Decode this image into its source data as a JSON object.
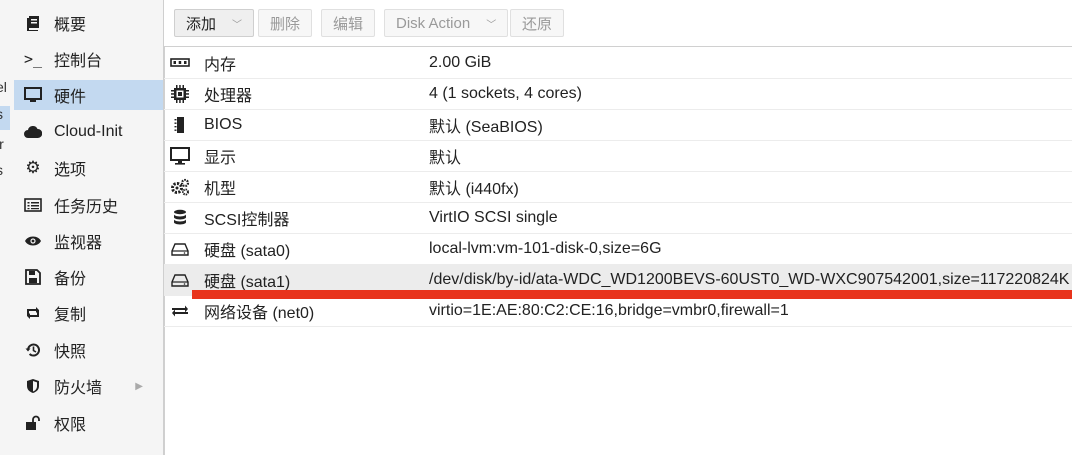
{
  "left_fragments": [
    "el",
    "s",
    "ir",
    "s"
  ],
  "nav": {
    "items": [
      {
        "label": "概要",
        "icon": "summary-icon"
      },
      {
        "label": "控制台",
        "icon": "console-icon"
      },
      {
        "label": "硬件",
        "icon": "monitor-icon",
        "active": true
      },
      {
        "label": "Cloud-Init",
        "icon": "cloud-icon"
      },
      {
        "label": "选项",
        "icon": "gear-icon"
      },
      {
        "label": "任务历史",
        "icon": "list-icon"
      },
      {
        "label": "监视器",
        "icon": "eye-icon"
      },
      {
        "label": "备份",
        "icon": "floppy-icon"
      },
      {
        "label": "复制",
        "icon": "retweet-icon"
      },
      {
        "label": "快照",
        "icon": "history-icon"
      },
      {
        "label": "防火墙",
        "icon": "shield-icon",
        "chevron": true
      },
      {
        "label": "权限",
        "icon": "unlock-icon"
      }
    ]
  },
  "toolbar": {
    "add_label": "添加",
    "remove_label": "删除",
    "edit_label": "编辑",
    "disk_action_label": "Disk Action",
    "revert_label": "还原"
  },
  "hardware": {
    "rows": [
      {
        "name": "内存",
        "value": "2.00 GiB",
        "icon": "memory-icon"
      },
      {
        "name": "处理器",
        "value": "4 (1 sockets, 4 cores)",
        "icon": "cpu-icon"
      },
      {
        "name": "BIOS",
        "value": "默认 (SeaBIOS)",
        "icon": "microchip-icon"
      },
      {
        "name": "显示",
        "value": "默认",
        "icon": "desktop-icon"
      },
      {
        "name": "机型",
        "value": "默认 (i440fx)",
        "icon": "cogs-icon"
      },
      {
        "name": "SCSI控制器",
        "value": "VirtIO SCSI single",
        "icon": "database-icon"
      },
      {
        "name": "硬盘 (sata0)",
        "value": "local-lvm:vm-101-disk-0,size=6G",
        "icon": "hdd-icon"
      },
      {
        "name": "硬盘 (sata1)",
        "value": "/dev/disk/by-id/ata-WDC_WD1200BEVS-60UST0_WD-WXC907542001,size=117220824K",
        "icon": "hdd-icon",
        "selected": true
      },
      {
        "name": "网络设备 (net0)",
        "value": "virtio=1E:AE:80:C2:CE:16,bridge=vmbr0,firewall=1",
        "icon": "exchange-icon"
      }
    ]
  },
  "colors": {
    "accent_selected": "#c3d9f0",
    "annotation_red": "#e8341c"
  }
}
